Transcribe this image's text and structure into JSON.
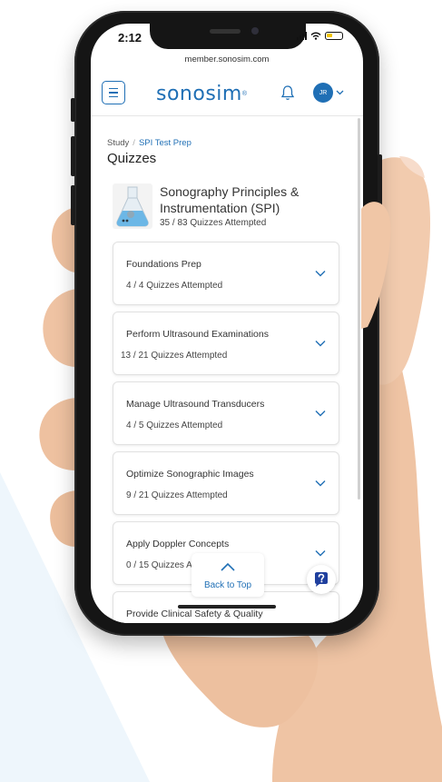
{
  "status_bar": {
    "time": "2:12"
  },
  "browser": {
    "url": "member.sonosim.com"
  },
  "header": {
    "logo_text": "sonosim",
    "logo_mark": "®",
    "avatar_initials": "JR"
  },
  "breadcrumb": {
    "root": "Study",
    "separator": "/",
    "current": "SPI Test Prep"
  },
  "page": {
    "title": "Quizzes"
  },
  "course": {
    "name_line1": "Sonography Principles &",
    "name_line2": "Instrumentation (SPI)",
    "progress": "35 / 83 Quizzes Attempted"
  },
  "sections": [
    {
      "title": "Foundations Prep",
      "progress": "4 / 4 Quizzes Attempted"
    },
    {
      "title": "Perform Ultrasound Examinations",
      "progress": "13 / 21 Quizzes Attempted"
    },
    {
      "title": "Manage Ultrasound Transducers",
      "progress": "4 / 5 Quizzes Attempted"
    },
    {
      "title": "Optimize Sonographic Images",
      "progress": "9 / 21 Quizzes Attempted"
    },
    {
      "title": "Apply Doppler Concepts",
      "progress": "0 / 15 Quizzes Attempted"
    },
    {
      "title": "Provide Clinical Safety & Quality",
      "progress": ""
    }
  ],
  "back_to_top": {
    "label": "Back to Top"
  },
  "colors": {
    "brand_blue": "#1f6fb5",
    "wedge": "#eef6fc",
    "skin": "#f0c7a8",
    "skin_shadow": "#d9a688"
  }
}
